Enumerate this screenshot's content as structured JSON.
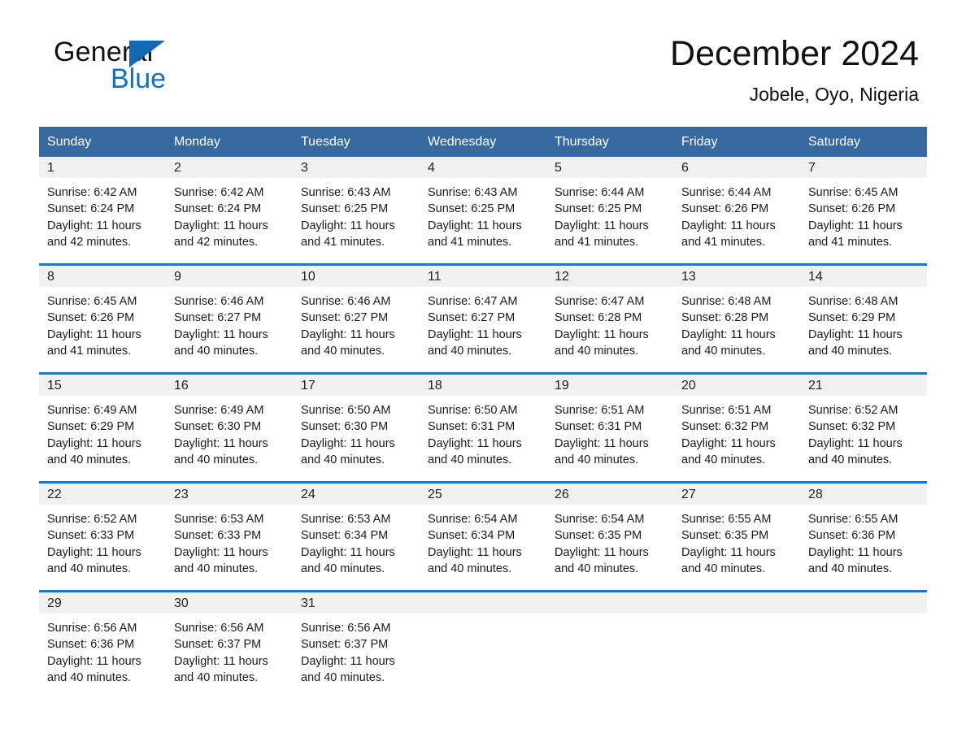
{
  "brand": {
    "name_part1": "General",
    "name_part2": "Blue",
    "accent_color": "#1270c0",
    "triangle_color": "#1567b2"
  },
  "header": {
    "month_title": "December 2024",
    "location": "Jobele, Oyo, Nigeria"
  },
  "calendar": {
    "header_bg": "#36699f",
    "row_divider_color": "#2a72b5",
    "daynum_band_bg": "#f1f1f1",
    "weekday_headers": [
      "Sunday",
      "Monday",
      "Tuesday",
      "Wednesday",
      "Thursday",
      "Friday",
      "Saturday"
    ],
    "weeks": [
      [
        {
          "day": "1",
          "sunrise": "Sunrise: 6:42 AM",
          "sunset": "Sunset: 6:24 PM",
          "daylight_line1": "Daylight: 11 hours",
          "daylight_line2": "and 42 minutes."
        },
        {
          "day": "2",
          "sunrise": "Sunrise: 6:42 AM",
          "sunset": "Sunset: 6:24 PM",
          "daylight_line1": "Daylight: 11 hours",
          "daylight_line2": "and 42 minutes."
        },
        {
          "day": "3",
          "sunrise": "Sunrise: 6:43 AM",
          "sunset": "Sunset: 6:25 PM",
          "daylight_line1": "Daylight: 11 hours",
          "daylight_line2": "and 41 minutes."
        },
        {
          "day": "4",
          "sunrise": "Sunrise: 6:43 AM",
          "sunset": "Sunset: 6:25 PM",
          "daylight_line1": "Daylight: 11 hours",
          "daylight_line2": "and 41 minutes."
        },
        {
          "day": "5",
          "sunrise": "Sunrise: 6:44 AM",
          "sunset": "Sunset: 6:25 PM",
          "daylight_line1": "Daylight: 11 hours",
          "daylight_line2": "and 41 minutes."
        },
        {
          "day": "6",
          "sunrise": "Sunrise: 6:44 AM",
          "sunset": "Sunset: 6:26 PM",
          "daylight_line1": "Daylight: 11 hours",
          "daylight_line2": "and 41 minutes."
        },
        {
          "day": "7",
          "sunrise": "Sunrise: 6:45 AM",
          "sunset": "Sunset: 6:26 PM",
          "daylight_line1": "Daylight: 11 hours",
          "daylight_line2": "and 41 minutes."
        }
      ],
      [
        {
          "day": "8",
          "sunrise": "Sunrise: 6:45 AM",
          "sunset": "Sunset: 6:26 PM",
          "daylight_line1": "Daylight: 11 hours",
          "daylight_line2": "and 41 minutes."
        },
        {
          "day": "9",
          "sunrise": "Sunrise: 6:46 AM",
          "sunset": "Sunset: 6:27 PM",
          "daylight_line1": "Daylight: 11 hours",
          "daylight_line2": "and 40 minutes."
        },
        {
          "day": "10",
          "sunrise": "Sunrise: 6:46 AM",
          "sunset": "Sunset: 6:27 PM",
          "daylight_line1": "Daylight: 11 hours",
          "daylight_line2": "and 40 minutes."
        },
        {
          "day": "11",
          "sunrise": "Sunrise: 6:47 AM",
          "sunset": "Sunset: 6:27 PM",
          "daylight_line1": "Daylight: 11 hours",
          "daylight_line2": "and 40 minutes."
        },
        {
          "day": "12",
          "sunrise": "Sunrise: 6:47 AM",
          "sunset": "Sunset: 6:28 PM",
          "daylight_line1": "Daylight: 11 hours",
          "daylight_line2": "and 40 minutes."
        },
        {
          "day": "13",
          "sunrise": "Sunrise: 6:48 AM",
          "sunset": "Sunset: 6:28 PM",
          "daylight_line1": "Daylight: 11 hours",
          "daylight_line2": "and 40 minutes."
        },
        {
          "day": "14",
          "sunrise": "Sunrise: 6:48 AM",
          "sunset": "Sunset: 6:29 PM",
          "daylight_line1": "Daylight: 11 hours",
          "daylight_line2": "and 40 minutes."
        }
      ],
      [
        {
          "day": "15",
          "sunrise": "Sunrise: 6:49 AM",
          "sunset": "Sunset: 6:29 PM",
          "daylight_line1": "Daylight: 11 hours",
          "daylight_line2": "and 40 minutes."
        },
        {
          "day": "16",
          "sunrise": "Sunrise: 6:49 AM",
          "sunset": "Sunset: 6:30 PM",
          "daylight_line1": "Daylight: 11 hours",
          "daylight_line2": "and 40 minutes."
        },
        {
          "day": "17",
          "sunrise": "Sunrise: 6:50 AM",
          "sunset": "Sunset: 6:30 PM",
          "daylight_line1": "Daylight: 11 hours",
          "daylight_line2": "and 40 minutes."
        },
        {
          "day": "18",
          "sunrise": "Sunrise: 6:50 AM",
          "sunset": "Sunset: 6:31 PM",
          "daylight_line1": "Daylight: 11 hours",
          "daylight_line2": "and 40 minutes."
        },
        {
          "day": "19",
          "sunrise": "Sunrise: 6:51 AM",
          "sunset": "Sunset: 6:31 PM",
          "daylight_line1": "Daylight: 11 hours",
          "daylight_line2": "and 40 minutes."
        },
        {
          "day": "20",
          "sunrise": "Sunrise: 6:51 AM",
          "sunset": "Sunset: 6:32 PM",
          "daylight_line1": "Daylight: 11 hours",
          "daylight_line2": "and 40 minutes."
        },
        {
          "day": "21",
          "sunrise": "Sunrise: 6:52 AM",
          "sunset": "Sunset: 6:32 PM",
          "daylight_line1": "Daylight: 11 hours",
          "daylight_line2": "and 40 minutes."
        }
      ],
      [
        {
          "day": "22",
          "sunrise": "Sunrise: 6:52 AM",
          "sunset": "Sunset: 6:33 PM",
          "daylight_line1": "Daylight: 11 hours",
          "daylight_line2": "and 40 minutes."
        },
        {
          "day": "23",
          "sunrise": "Sunrise: 6:53 AM",
          "sunset": "Sunset: 6:33 PM",
          "daylight_line1": "Daylight: 11 hours",
          "daylight_line2": "and 40 minutes."
        },
        {
          "day": "24",
          "sunrise": "Sunrise: 6:53 AM",
          "sunset": "Sunset: 6:34 PM",
          "daylight_line1": "Daylight: 11 hours",
          "daylight_line2": "and 40 minutes."
        },
        {
          "day": "25",
          "sunrise": "Sunrise: 6:54 AM",
          "sunset": "Sunset: 6:34 PM",
          "daylight_line1": "Daylight: 11 hours",
          "daylight_line2": "and 40 minutes."
        },
        {
          "day": "26",
          "sunrise": "Sunrise: 6:54 AM",
          "sunset": "Sunset: 6:35 PM",
          "daylight_line1": "Daylight: 11 hours",
          "daylight_line2": "and 40 minutes."
        },
        {
          "day": "27",
          "sunrise": "Sunrise: 6:55 AM",
          "sunset": "Sunset: 6:35 PM",
          "daylight_line1": "Daylight: 11 hours",
          "daylight_line2": "and 40 minutes."
        },
        {
          "day": "28",
          "sunrise": "Sunrise: 6:55 AM",
          "sunset": "Sunset: 6:36 PM",
          "daylight_line1": "Daylight: 11 hours",
          "daylight_line2": "and 40 minutes."
        }
      ],
      [
        {
          "day": "29",
          "sunrise": "Sunrise: 6:56 AM",
          "sunset": "Sunset: 6:36 PM",
          "daylight_line1": "Daylight: 11 hours",
          "daylight_line2": "and 40 minutes."
        },
        {
          "day": "30",
          "sunrise": "Sunrise: 6:56 AM",
          "sunset": "Sunset: 6:37 PM",
          "daylight_line1": "Daylight: 11 hours",
          "daylight_line2": "and 40 minutes."
        },
        {
          "day": "31",
          "sunrise": "Sunrise: 6:56 AM",
          "sunset": "Sunset: 6:37 PM",
          "daylight_line1": "Daylight: 11 hours",
          "daylight_line2": "and 40 minutes."
        },
        {
          "day": "",
          "sunrise": "",
          "sunset": "",
          "daylight_line1": "",
          "daylight_line2": ""
        },
        {
          "day": "",
          "sunrise": "",
          "sunset": "",
          "daylight_line1": "",
          "daylight_line2": ""
        },
        {
          "day": "",
          "sunrise": "",
          "sunset": "",
          "daylight_line1": "",
          "daylight_line2": ""
        },
        {
          "day": "",
          "sunrise": "",
          "sunset": "",
          "daylight_line1": "",
          "daylight_line2": ""
        }
      ]
    ]
  }
}
